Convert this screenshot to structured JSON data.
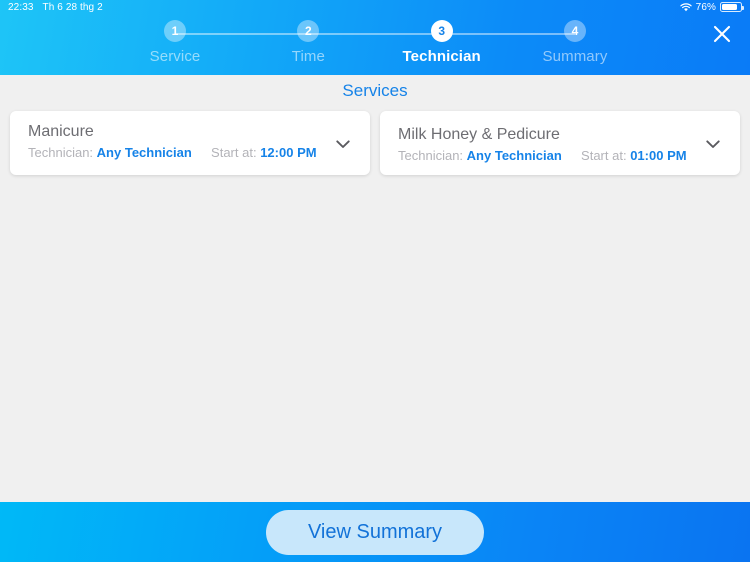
{
  "statusbar": {
    "time": "22:33",
    "date": "Th 6 28 thg 2",
    "battery_percent": "76%",
    "wifi_icon": "wifi-icon",
    "battery_icon": "battery-icon"
  },
  "header": {
    "close_icon": "close-icon",
    "steps": [
      {
        "number": "1",
        "label": "Service",
        "active": false
      },
      {
        "number": "2",
        "label": "Time",
        "active": false
      },
      {
        "number": "3",
        "label": "Technician",
        "active": true
      },
      {
        "number": "4",
        "label": "Summary",
        "active": false
      }
    ]
  },
  "main": {
    "section_title": "Services",
    "technician_prefix": "Technician:",
    "start_prefix": "Start at:",
    "chevron_icon": "chevron-down-icon",
    "services": [
      {
        "name": "Manicure",
        "technician": "Any Technician",
        "start_at": "12:00 PM"
      },
      {
        "name": "Milk Honey & Pedicure",
        "technician": "Any Technician",
        "start_at": "01:00 PM"
      }
    ]
  },
  "footer": {
    "primary_button": "View Summary"
  },
  "colors": {
    "accent_blue": "#1683e8",
    "header_gradient_start": "#1ec5f7",
    "header_gradient_end": "#0a7bf7",
    "page_background": "#f0f0f0",
    "button_background": "#c8e7fb",
    "button_text": "#1272d8"
  }
}
